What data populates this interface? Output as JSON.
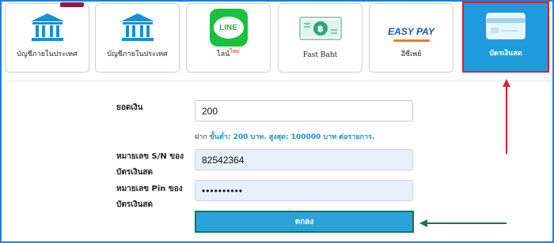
{
  "payment_methods": [
    {
      "label": "บัญชีภายในประเทศ",
      "icon": "bank-icon",
      "badge": true
    },
    {
      "label": "บัญชีภายในประเทศ",
      "icon": "bank-icon"
    },
    {
      "label": "ไลน์",
      "new_tag": "ใหม่",
      "icon": "line-icon",
      "icon_text": "LINE"
    },
    {
      "label": "Fast Baht",
      "icon": "baht-banknote-icon"
    },
    {
      "label": "อีซี่เพย์",
      "icon": "easy-pay-logo",
      "icon_text": "EASY PAY"
    },
    {
      "label": "บัตรเงินสด",
      "icon": "card-icon",
      "selected": true
    }
  ],
  "form": {
    "amount_label": "ยอดเงิน",
    "amount_value": "200",
    "hint_prefix": "ฝาก",
    "hint_detail": "ขั้นต่ำ: 200 บาท. สูงสุด: 100000 บาท ต่อรายการ.",
    "serial_label_line1": "หมายเลข S/N ของ",
    "serial_label_line2": "บัตรเงินสด",
    "serial_value": "82542364",
    "pin_label_line1": "หมายเลข Pin ของ",
    "pin_label_line2": "บัตรเงินสด",
    "pin_value": "••••••••••",
    "submit_label": "ตกลง"
  },
  "colors": {
    "accent": "#1d9bdd",
    "highlight_red": "#d8232a",
    "highlight_green": "#0d7a4a",
    "line_green": "#19c23c"
  }
}
